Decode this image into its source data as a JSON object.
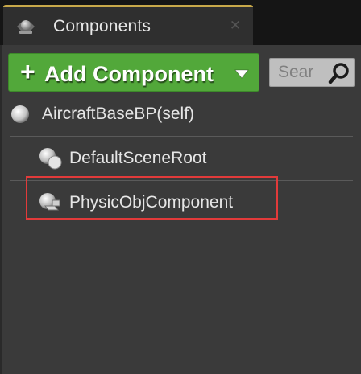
{
  "tab": {
    "title": "Components",
    "close_glyph": "✕",
    "icon": "components-panel-icon"
  },
  "toolbar": {
    "add_button_plus": "+",
    "add_button_label": "Add Component",
    "add_button_color": "#52a83a",
    "search_placeholder": "Sear"
  },
  "tree": {
    "items": [
      {
        "label": "AircraftBaseBP(self)",
        "icon": "sphere-icon"
      },
      {
        "label": "DefaultSceneRoot",
        "icon": "scene-root-icon"
      },
      {
        "label": "PhysicObjComponent",
        "icon": "physics-object-icon",
        "highlighted": true
      }
    ]
  },
  "colors": {
    "highlight_border": "#e23a3a",
    "panel_background": "#3a3a3a",
    "tab_accent": "#c8a84a"
  }
}
